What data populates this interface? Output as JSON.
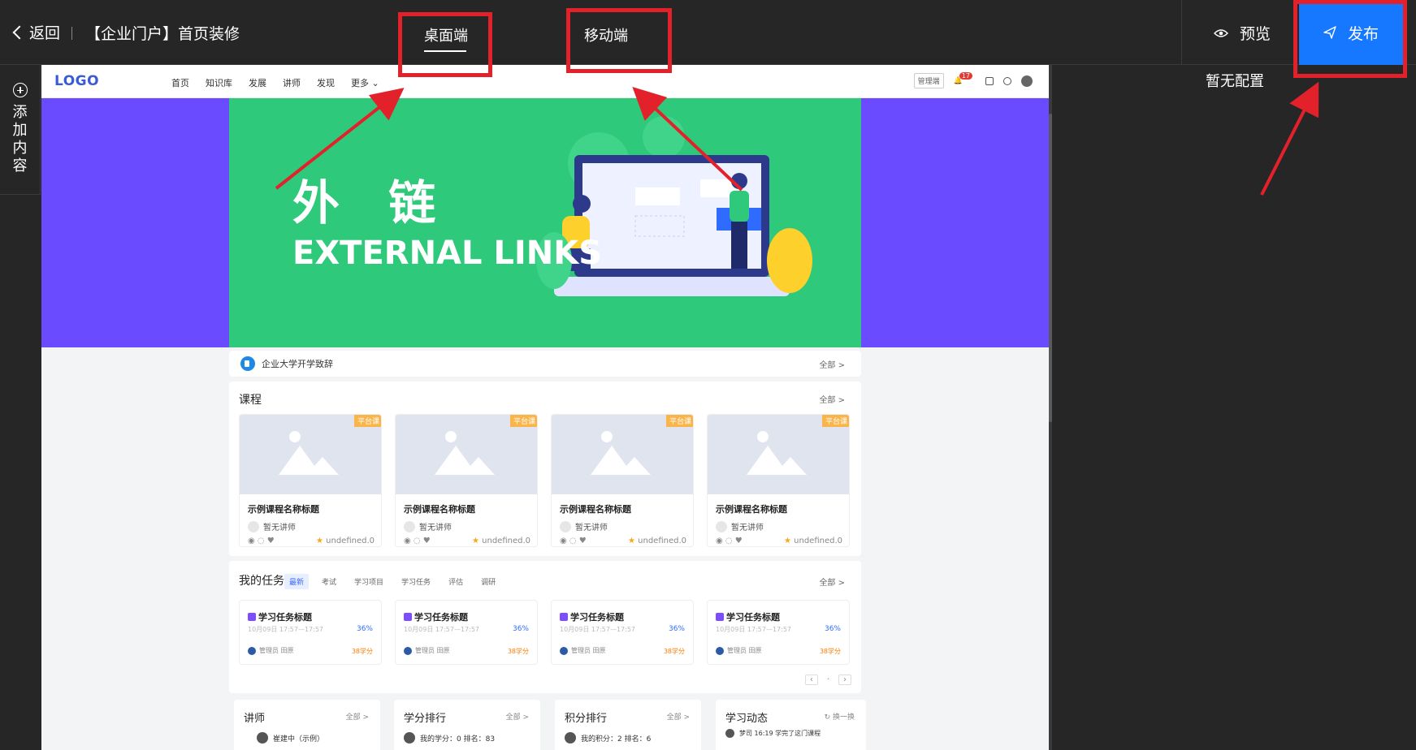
{
  "topbar": {
    "back_label": "返回",
    "page_title": "【企业门户】首页装修",
    "tabs": [
      {
        "label": "桌面端",
        "active": true
      },
      {
        "label": "移动端",
        "active": false
      }
    ],
    "preview_label": "预览",
    "publish_label": "发布"
  },
  "left_rail": {
    "add_content_label": "添加内容"
  },
  "right_panel": {
    "empty_text": "暂无配置"
  },
  "portal": {
    "logo": "LOGO",
    "nav": [
      "首页",
      "知识库",
      "发展",
      "讲师",
      "发现",
      "更多"
    ],
    "nav_right": {
      "manage_label": "管理端",
      "notification_count": "17"
    },
    "banner": {
      "title_cn": "外 链",
      "title_en": "EXTERNAL LINKS"
    },
    "notice": {
      "text": "企业大学开学致辞",
      "more": "全部 >"
    },
    "courses": {
      "title": "课程",
      "more": "全部 >",
      "items": [
        {
          "tag": "平台课",
          "title": "示例课程名称标题",
          "teacher": "暂无讲师",
          "rating": "undefined.0"
        },
        {
          "tag": "平台课",
          "title": "示例课程名称标题",
          "teacher": "暂无讲师",
          "rating": "undefined.0"
        },
        {
          "tag": "平台课",
          "title": "示例课程名称标题",
          "teacher": "暂无讲师",
          "rating": "undefined.0"
        },
        {
          "tag": "平台课",
          "title": "示例课程名称标题",
          "teacher": "暂无讲师",
          "rating": "undefined.0"
        }
      ]
    },
    "tasks": {
      "title": "我的任务",
      "more": "全部 >",
      "tabs": [
        "最新",
        "考试",
        "学习项目",
        "学习任务",
        "评估",
        "调研"
      ],
      "items": [
        {
          "title": "学习任务标题",
          "date": "10月09日 17:57—17:57",
          "percent": "36%",
          "owner": "管理员 田原",
          "score": "38学分"
        },
        {
          "title": "学习任务标题",
          "date": "10月09日 17:57—17:57",
          "percent": "36%",
          "owner": "管理员 田原",
          "score": "38学分"
        },
        {
          "title": "学习任务标题",
          "date": "10月09日 17:57—17:57",
          "percent": "36%",
          "owner": "管理员 田原",
          "score": "38学分"
        },
        {
          "title": "学习任务标题",
          "date": "10月09日 17:57—17:57",
          "percent": "36%",
          "owner": "管理员 田原",
          "score": "38学分"
        }
      ]
    },
    "bottom_cards": [
      {
        "title": "讲师",
        "more": "全部 >",
        "row": "崔建中（示例）"
      },
      {
        "title": "学分排行",
        "more": "全部 >",
        "row": "我的学分：0   排名：83"
      },
      {
        "title": "积分排行",
        "more": "全部 >",
        "row": "我的积分：2   排名：6"
      },
      {
        "title": "学习动态",
        "more": "换一换",
        "row": "梦司  16:19 学完了这门课程"
      }
    ]
  },
  "colors": {
    "accent": "#1677ff",
    "annotation": "#e3212b",
    "banner_green": "#2ec97a",
    "banner_purple": "#6b4bff"
  }
}
